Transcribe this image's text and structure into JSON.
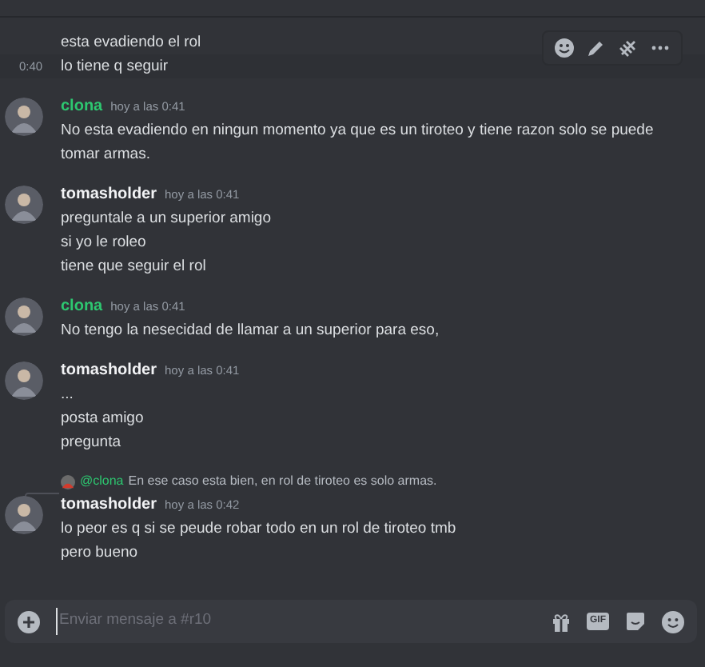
{
  "messages": [
    {
      "kind": "line",
      "text": "esta evadiendo el rol",
      "hovered": false
    },
    {
      "kind": "line",
      "timestamp": "0:40",
      "text": "lo tiene q seguir",
      "hovered": true
    },
    {
      "kind": "group",
      "author": "clona",
      "color": "#2dc770",
      "time": "hoy a las 0:41",
      "lines": [
        "No esta evadiendo en ningun momento ya que es un tiroteo y tiene razon solo se puede tomar armas."
      ]
    },
    {
      "kind": "group",
      "author": "tomasholder",
      "color": "#f2f3f5",
      "time": "hoy a las 0:41",
      "lines": [
        "preguntale a un superior amigo",
        "si yo le roleo",
        "tiene que seguir el rol"
      ]
    },
    {
      "kind": "group",
      "author": "clona",
      "color": "#2dc770",
      "time": "hoy a las 0:41",
      "lines": [
        "No tengo la nesecidad de llamar a un superior para eso,"
      ]
    },
    {
      "kind": "group",
      "author": "tomasholder",
      "color": "#f2f3f5",
      "time": "hoy a las 0:41",
      "lines": [
        "...",
        "posta amigo",
        "pregunta"
      ]
    },
    {
      "kind": "group",
      "author": "tomasholder",
      "color": "#f2f3f5",
      "time": "hoy a las 0:42",
      "reply": {
        "mention": "@clona",
        "text": "En ese caso esta bien, en rol de tiroteo es solo armas."
      },
      "lines": [
        "lo peor es q si se peude robar todo en un rol de tiroteo tmb",
        "pero bueno"
      ]
    }
  ],
  "composer": {
    "placeholder": "Enviar mensaje a #r10",
    "gif_label": "GIF"
  }
}
